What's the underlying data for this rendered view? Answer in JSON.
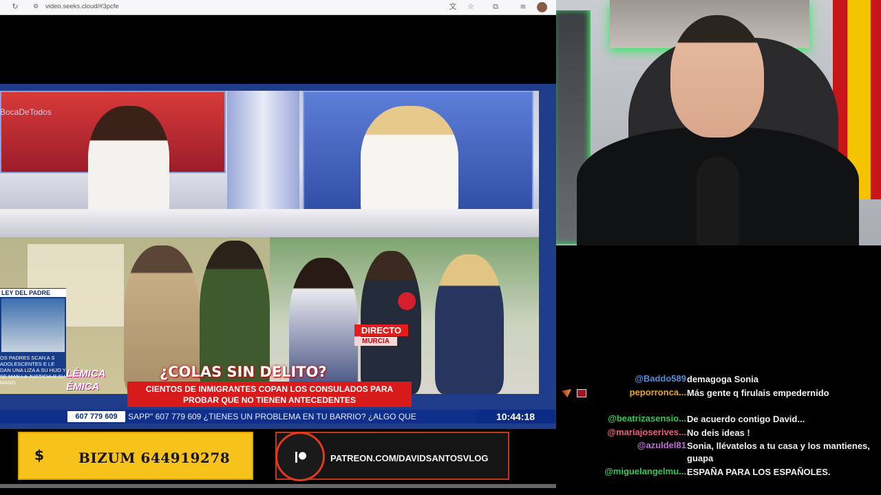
{
  "browser": {
    "url": "video.seeks.cloud/#3pcfe"
  },
  "broadcast": {
    "brand": "BocaDeTodos",
    "headline": "¿COLAS SIN DELITO?",
    "subheadline": "CIENTOS DE INMIGRANTES COPAN LOS CONSULADOS PARA PROBAR QUE NO TIENEN ANTECEDENTES",
    "live_label": "DIRECTO",
    "location_label": "MURCIA",
    "ticker_phone": "607 779 609",
    "ticker_text": "SAPP\" 607 779 609  ¿TIENES UN PROBLEMA EN TU BARRIO? ¿ALGO QUE",
    "clock": "10:44:18",
    "inset_title": "LEY DEL PADRE",
    "inset_text": "OS PADRES SCAN A S ADOLESCENTES E LE DAN UNA LIZA A SU HIJO Y SE MAN LA JUSTICIA R SU MANO",
    "polemica_1": "LÉMICA",
    "polemica_2": "ÉMICA"
  },
  "promo": {
    "bizum_symbol": "$",
    "bizum_text": "BIZUM 644919278",
    "patreon_text": "PATREON.COM/DAVIDSANTOSVLOG"
  },
  "chat": [
    {
      "user": "@Baddo589",
      "text": "demagoga Sonia",
      "color": "#4f8fd8",
      "badge": false
    },
    {
      "user": "peporronca...",
      "text": "Más gente q firulais empedernido",
      "color": "#e8a62a",
      "badge": true
    },
    {
      "user": "@beatrizasensio...",
      "text": "De acuerdo contigo David...",
      "color": "#34c759",
      "badge": false
    },
    {
      "user": "@mariajoserives...",
      "text": "No deis ideas !",
      "color": "#e8607a",
      "badge": false
    },
    {
      "user": "@azuldel81",
      "text": "Sonia, llévatelos a tu casa y los mantienes, guapa",
      "color": "#c26bd6",
      "badge": false
    },
    {
      "user": "@miguelangelmu...",
      "text": "ESPAÑA PARA LOS ESPAÑOLES.",
      "color": "#34c759",
      "badge": false
    }
  ]
}
